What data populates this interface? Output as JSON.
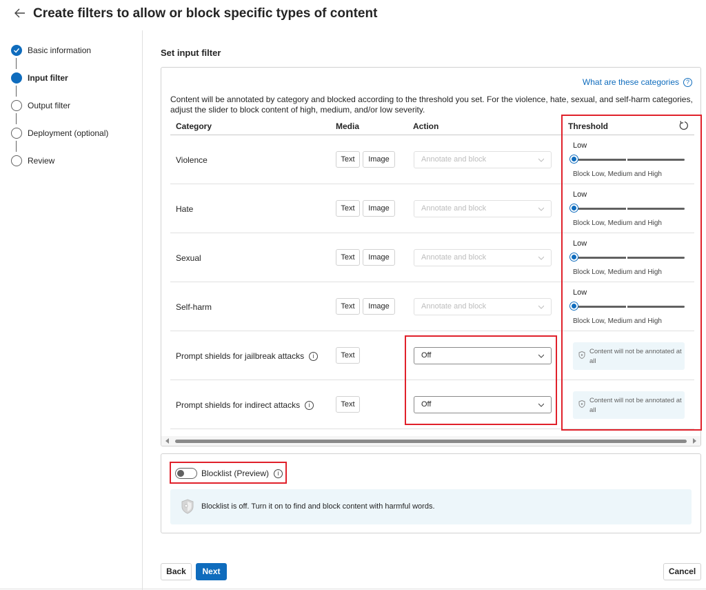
{
  "header": {
    "title": "Create filters to allow or block specific types of content"
  },
  "steps": [
    {
      "label": "Basic information",
      "state": "done"
    },
    {
      "label": "Input filter",
      "state": "current"
    },
    {
      "label": "Output filter",
      "state": "pending"
    },
    {
      "label": "Deployment (optional)",
      "state": "pending"
    },
    {
      "label": "Review",
      "state": "pending"
    }
  ],
  "section": {
    "title": "Set input filter"
  },
  "card": {
    "help_link": "What are these categories",
    "description": "Content will be annotated by category and blocked according to the threshold you set. For the violence, hate, sexual, and self-harm categories, adjust the slider to block content of high, medium, and/or low severity.",
    "columns": {
      "category": "Category",
      "media": "Media",
      "action": "Action",
      "threshold": "Threshold"
    },
    "rows": [
      {
        "category": "Violence",
        "media": [
          "Text",
          "Image"
        ],
        "action": "Annotate and block",
        "threshold_label": "Low",
        "threshold_desc": "Block Low, Medium and High"
      },
      {
        "category": "Hate",
        "media": [
          "Text",
          "Image"
        ],
        "action": "Annotate and block",
        "threshold_label": "Low",
        "threshold_desc": "Block Low, Medium and High"
      },
      {
        "category": "Sexual",
        "media": [
          "Text",
          "Image"
        ],
        "action": "Annotate and block",
        "threshold_label": "Low",
        "threshold_desc": "Block Low, Medium and High"
      },
      {
        "category": "Self-harm",
        "media": [
          "Text",
          "Image"
        ],
        "action": "Annotate and block",
        "threshold_label": "Low",
        "threshold_desc": "Block Low, Medium and High"
      },
      {
        "category": "Prompt shields for jailbreak attacks",
        "media": [
          "Text"
        ],
        "action": "Off",
        "threshold_note": "Content will not be annotated at all"
      },
      {
        "category": "Prompt shields for indirect attacks",
        "media": [
          "Text"
        ],
        "action": "Off",
        "threshold_note": "Content will not be annotated at all"
      }
    ]
  },
  "blocklist": {
    "label": "Blocklist (Preview)",
    "enabled": false,
    "banner": "Blocklist is off. Turn it on to find and block content with harmful words."
  },
  "footer": {
    "back": "Back",
    "next": "Next",
    "cancel": "Cancel"
  },
  "colors": {
    "accent": "#0f6cbd",
    "highlight": "#e0202a",
    "info_bg": "#edf6fa"
  }
}
